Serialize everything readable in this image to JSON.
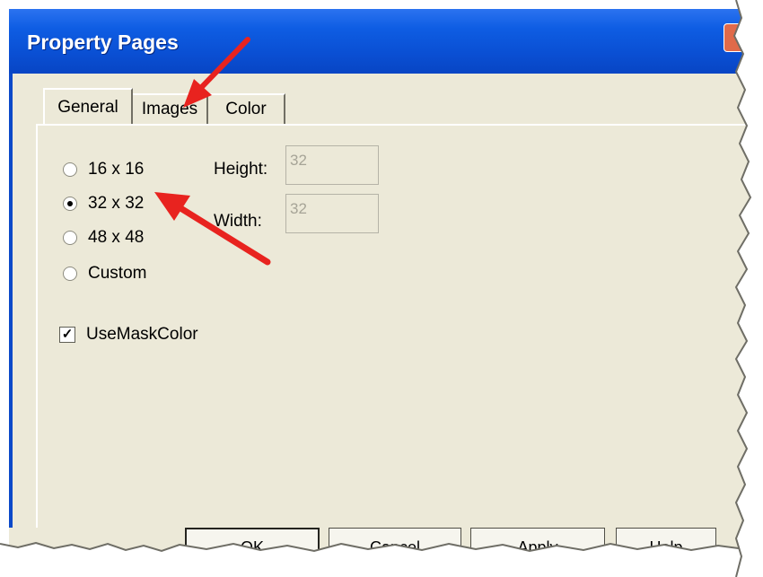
{
  "window": {
    "title": "Property Pages"
  },
  "tabs": [
    {
      "label": "General"
    },
    {
      "label": "Images"
    },
    {
      "label": "Color"
    }
  ],
  "size_options": [
    {
      "label": "16 x 16",
      "checked": false
    },
    {
      "label": "32 x 32",
      "checked": true
    },
    {
      "label": "48 x 48",
      "checked": false
    },
    {
      "label": "Custom",
      "checked": false
    }
  ],
  "fields": {
    "height_label": "Height:",
    "height_value": "32",
    "width_label": "Width:",
    "width_value": "32"
  },
  "mask": {
    "label": "UseMaskColor",
    "checked": true
  },
  "buttons": {
    "ok": "OK",
    "cancel": "Cancel",
    "apply": "Apply",
    "help": "Help"
  }
}
